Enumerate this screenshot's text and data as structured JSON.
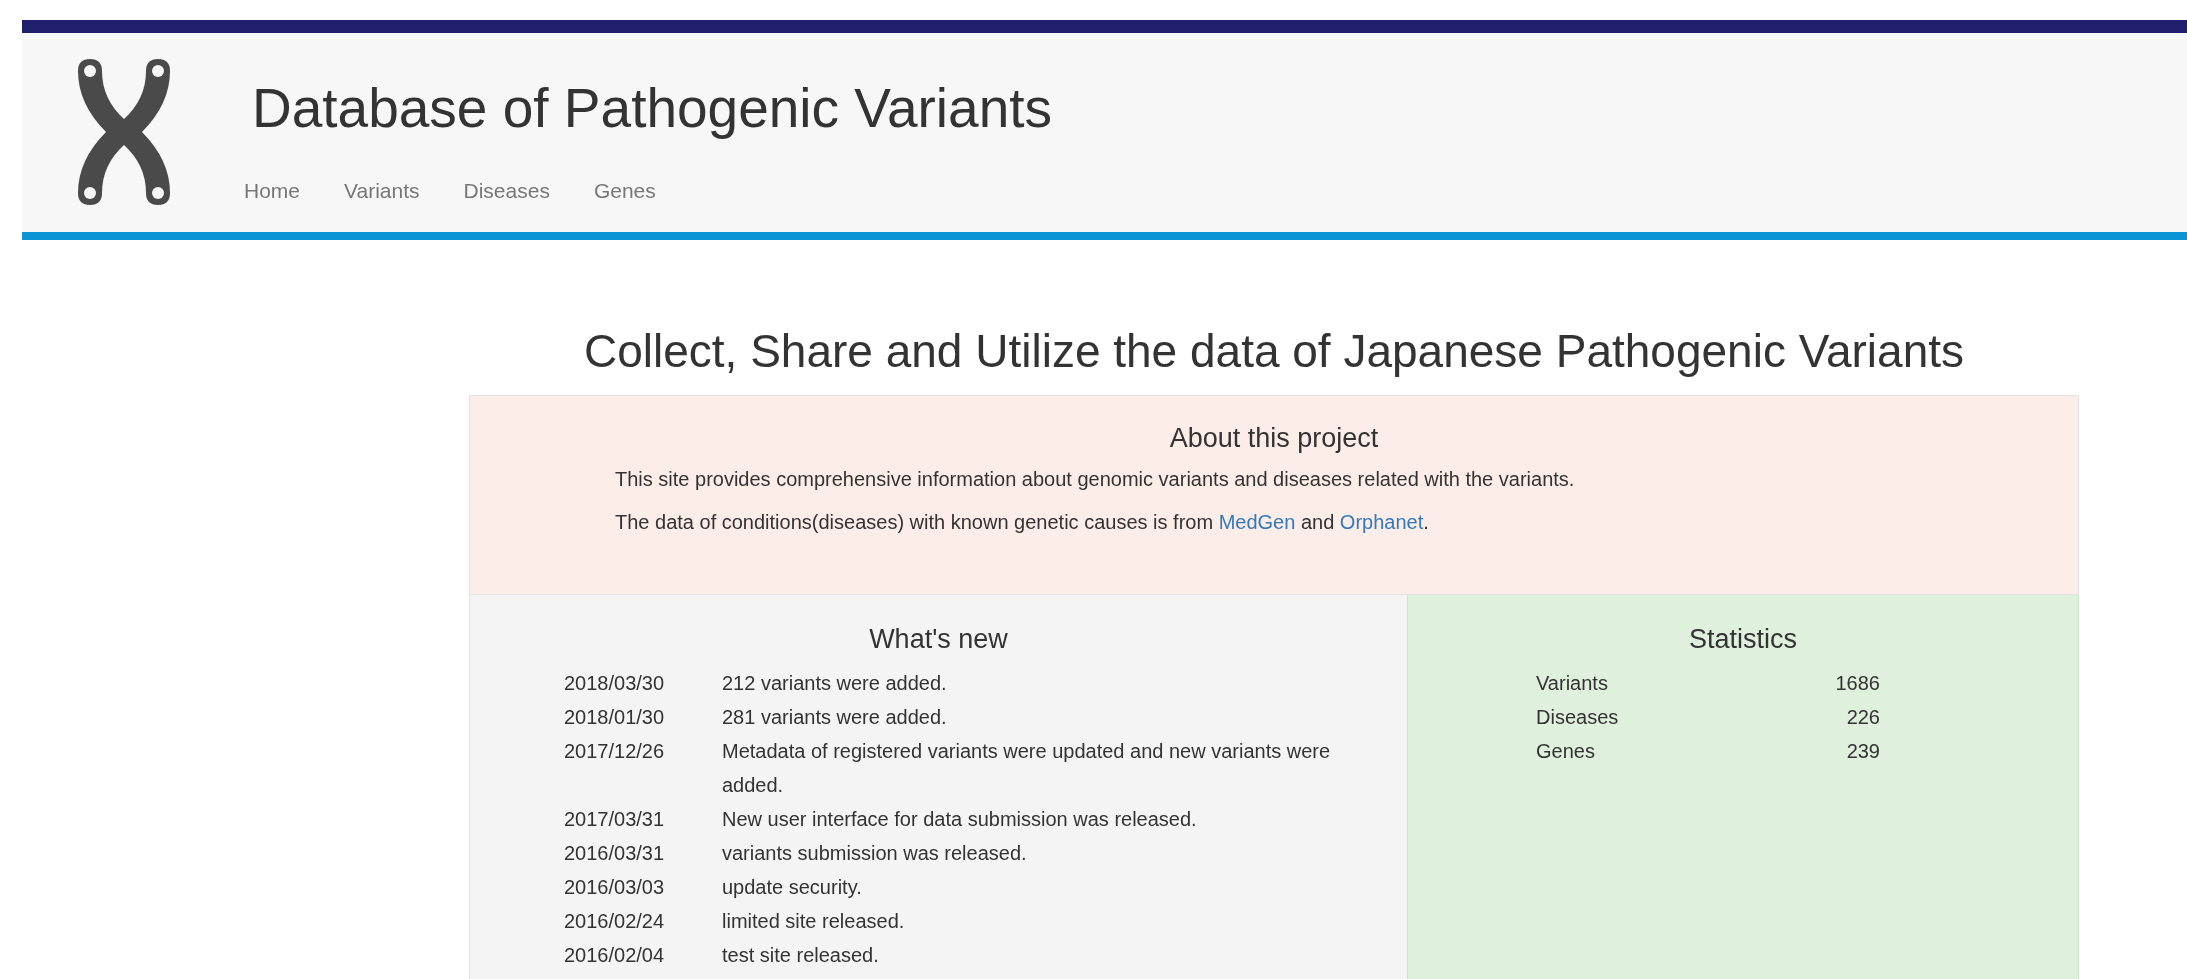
{
  "header": {
    "title": "Database of Pathogenic Variants",
    "nav": [
      {
        "label": "Home"
      },
      {
        "label": "Variants"
      },
      {
        "label": "Diseases"
      },
      {
        "label": "Genes"
      }
    ]
  },
  "headline": "Collect, Share and Utilize the data of Japanese Pathogenic Variants",
  "about": {
    "title": "About this project",
    "paragraphs": [
      [
        {
          "kind": "text",
          "text": "This site provides comprehensive information about genomic variants and diseases related with the variants."
        }
      ],
      [
        {
          "kind": "text",
          "text": "The data of conditions(diseases) with known genetic causes is from "
        },
        {
          "kind": "link",
          "text": "MedGen"
        },
        {
          "kind": "text",
          "text": " and "
        },
        {
          "kind": "link",
          "text": "Orphanet"
        },
        {
          "kind": "text",
          "text": "."
        }
      ]
    ]
  },
  "whats_new": {
    "title": "What's new",
    "items": [
      {
        "date": "2018/03/30",
        "text": "212 variants were added."
      },
      {
        "date": "2018/01/30",
        "text": "281 variants were added."
      },
      {
        "date": "2017/12/26",
        "text": "Metadata of registered variants were updated and new variants were added."
      },
      {
        "date": "2017/03/31",
        "text": "New user interface for data submission was released."
      },
      {
        "date": "2016/03/31",
        "text": "variants submission was released."
      },
      {
        "date": "2016/03/03",
        "text": "update security."
      },
      {
        "date": "2016/02/24",
        "text": "limited site released."
      },
      {
        "date": "2016/02/04",
        "text": "test site released."
      }
    ]
  },
  "statistics": {
    "title": "Statistics",
    "rows": [
      {
        "label": "Variants",
        "value": "1686"
      },
      {
        "label": "Diseases",
        "value": "226"
      },
      {
        "label": "Genes",
        "value": "239"
      }
    ]
  }
}
